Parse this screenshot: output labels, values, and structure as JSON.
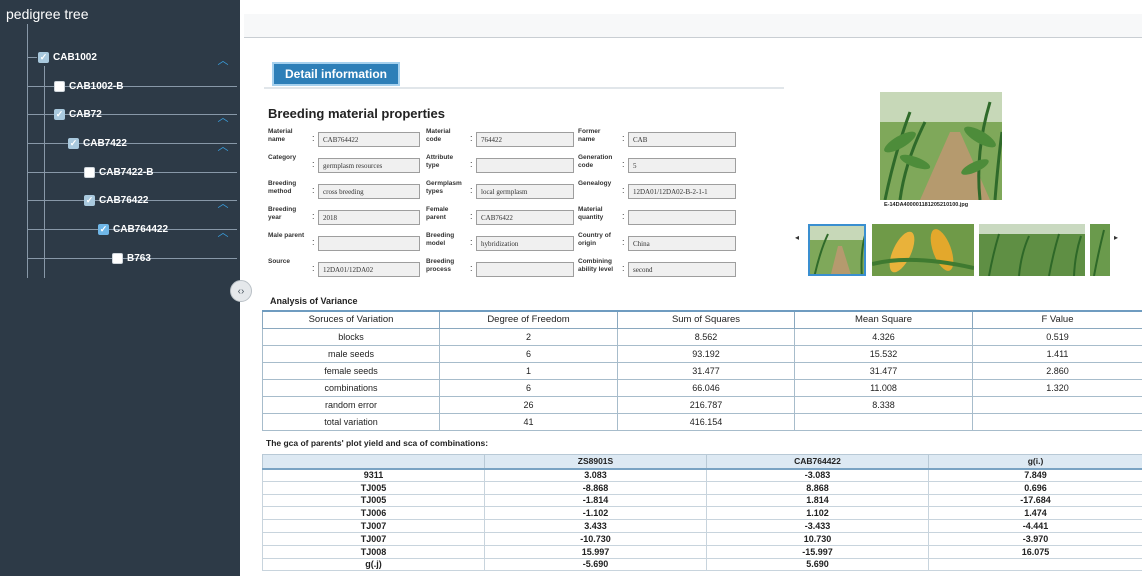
{
  "sidebar": {
    "title": "pedigree tree",
    "nodes": [
      {
        "label": "CAB1002",
        "checked": true
      },
      {
        "label": "CAB1002-B",
        "checked": false
      },
      {
        "label": "CAB72",
        "checked": true
      },
      {
        "label": "CAB7422",
        "checked": true
      },
      {
        "label": "CAB7422-B",
        "checked": false
      },
      {
        "label": "CAB76422",
        "checked": true
      },
      {
        "label": "CAB764422",
        "checked": true
      },
      {
        "label": "B763",
        "checked": false
      }
    ],
    "expand_icon": "chevron-up-icon",
    "collapse_handle": "‹›"
  },
  "tab": {
    "label": "Detail information"
  },
  "properties": {
    "title": "Breeding material properties",
    "fields": [
      {
        "label": "Material name",
        "value": "CAB764422"
      },
      {
        "label": "Material code",
        "value": "764422"
      },
      {
        "label": "Former name",
        "value": "CAB"
      },
      {
        "label": "Category",
        "value": "germplasm resources"
      },
      {
        "label": "Attribute type",
        "value": ""
      },
      {
        "label": "Generation code",
        "value": "5"
      },
      {
        "label": "Breeding method",
        "value": "cross breeding"
      },
      {
        "label": "Germplasm types",
        "value": "local germplasm"
      },
      {
        "label": "Genealogy",
        "value": "12DA01/12DA02-B-2-1-1"
      },
      {
        "label": "Breeding year",
        "value": "2018"
      },
      {
        "label": "Female parent",
        "value": "CAB76422"
      },
      {
        "label": "Material quantity",
        "value": ""
      },
      {
        "label": "Male parent",
        "value": ""
      },
      {
        "label": "Breeding model",
        "value": "hybridization"
      },
      {
        "label": "Country of origin",
        "value": "China"
      },
      {
        "label": "Source",
        "value": "12DA01/12DA02"
      },
      {
        "label": "Breeding process",
        "value": ""
      },
      {
        "label": "Combining ability level",
        "value": "second"
      }
    ]
  },
  "gallery": {
    "caption": "E-14DA400001181205210100.jpg",
    "prev_icon": "◂",
    "next_icon": "▸"
  },
  "aov": {
    "title": "Analysis of Variance",
    "headers": [
      "Soruces of Variation",
      "Degree of Freedom",
      "Sum of Squares",
      "Mean Square",
      "F Value"
    ],
    "rows": [
      [
        "blocks",
        "2",
        "8.562",
        "4.326",
        "0.519"
      ],
      [
        "male seeds",
        "6",
        "93.192",
        "15.532",
        "1.411"
      ],
      [
        "female seeds",
        "1",
        "31.477",
        "31.477",
        "2.860"
      ],
      [
        "combinations",
        "6",
        "66.046",
        "11.008",
        "1.320"
      ],
      [
        "random error",
        "26",
        "216.787",
        "8.338",
        ""
      ],
      [
        "total variation",
        "41",
        "416.154",
        "",
        ""
      ]
    ]
  },
  "gca": {
    "title": "The gca of parents' plot yield and sca of combinations:",
    "headers": [
      "",
      "ZS8901S",
      "CAB764422",
      "g(i.)"
    ],
    "rows": [
      [
        "9311",
        "3.083",
        "-3.083",
        "7.849"
      ],
      [
        "TJ005",
        "-8.868",
        "8.868",
        "0.696"
      ],
      [
        "TJ005",
        "-1.814",
        "1.814",
        "-17.684"
      ],
      [
        "TJ006",
        "-1.102",
        "1.102",
        "1.474"
      ],
      [
        "TJ007",
        "3.433",
        "-3.433",
        "-4.441"
      ],
      [
        "TJ007",
        "-10.730",
        "10.730",
        "-3.970"
      ],
      [
        "TJ008",
        "15.997",
        "-15.997",
        "16.075"
      ],
      [
        "g(.j)",
        "-5.690",
        "5.690",
        ""
      ]
    ]
  }
}
